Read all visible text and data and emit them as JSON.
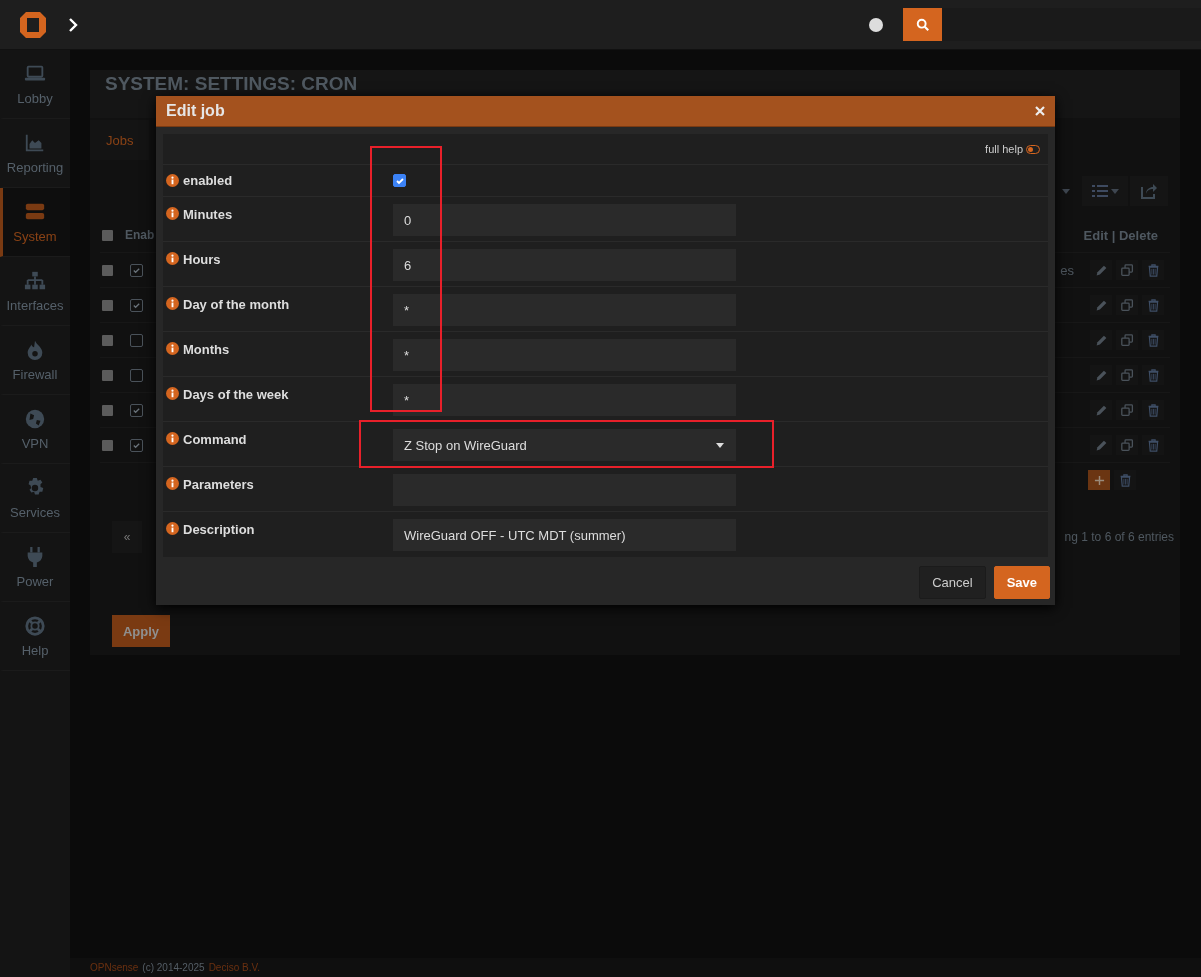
{
  "sidebar": {
    "items": [
      {
        "label": "Lobby",
        "selected": false
      },
      {
        "label": "Reporting",
        "selected": false
      },
      {
        "label": "System",
        "selected": true
      },
      {
        "label": "Interfaces",
        "selected": false
      },
      {
        "label": "Firewall",
        "selected": false
      },
      {
        "label": "VPN",
        "selected": false
      },
      {
        "label": "Services",
        "selected": false
      },
      {
        "label": "Power",
        "selected": false
      },
      {
        "label": "Help",
        "selected": false
      }
    ]
  },
  "page": {
    "title": "SYSTEM: SETTINGS: CRON",
    "tabs": [
      {
        "label": "Jobs",
        "selected": true
      }
    ],
    "table": {
      "columns": [
        "Enab",
        "Edit | Delete"
      ],
      "all_selected": false,
      "rows": [
        {
          "selected": false,
          "enabled": true,
          "column_3": "es"
        },
        {
          "selected": false,
          "enabled": true
        },
        {
          "selected": false,
          "enabled": false
        },
        {
          "selected": false,
          "enabled": false
        },
        {
          "selected": false,
          "enabled": true
        },
        {
          "selected": false,
          "enabled": true
        }
      ]
    },
    "pagination": {
      "first": "«"
    },
    "info": "ng 1 to 6 of 6 entries",
    "apply": "Apply"
  },
  "footer": {
    "brand": "OPNsense",
    "text": "(c) 2014-2025",
    "company": "Deciso B.V."
  },
  "dialog": {
    "title": "Edit job",
    "full_help": {
      "label": "full help",
      "on": false
    },
    "fields": [
      {
        "kind": "checkbox",
        "label": "enabled",
        "checked": true
      },
      {
        "kind": "text",
        "label": "Minutes",
        "value": "0"
      },
      {
        "kind": "text",
        "label": "Hours",
        "value": "6"
      },
      {
        "kind": "text",
        "label": "Day of the month",
        "value": "*"
      },
      {
        "kind": "text",
        "label": "Months",
        "value": "*"
      },
      {
        "kind": "text",
        "label": "Days of the week",
        "value": "*"
      },
      {
        "kind": "select",
        "label": "Command",
        "value": "Z Stop on WireGuard"
      },
      {
        "kind": "text",
        "label": "Parameters"
      },
      {
        "kind": "text",
        "label": "Description",
        "value": "WireGuard OFF - UTC MDT (summer)"
      }
    ],
    "buttons": [
      {
        "label": "Cancel",
        "kind": "default"
      },
      {
        "label": "Save",
        "kind": "primary"
      }
    ]
  }
}
